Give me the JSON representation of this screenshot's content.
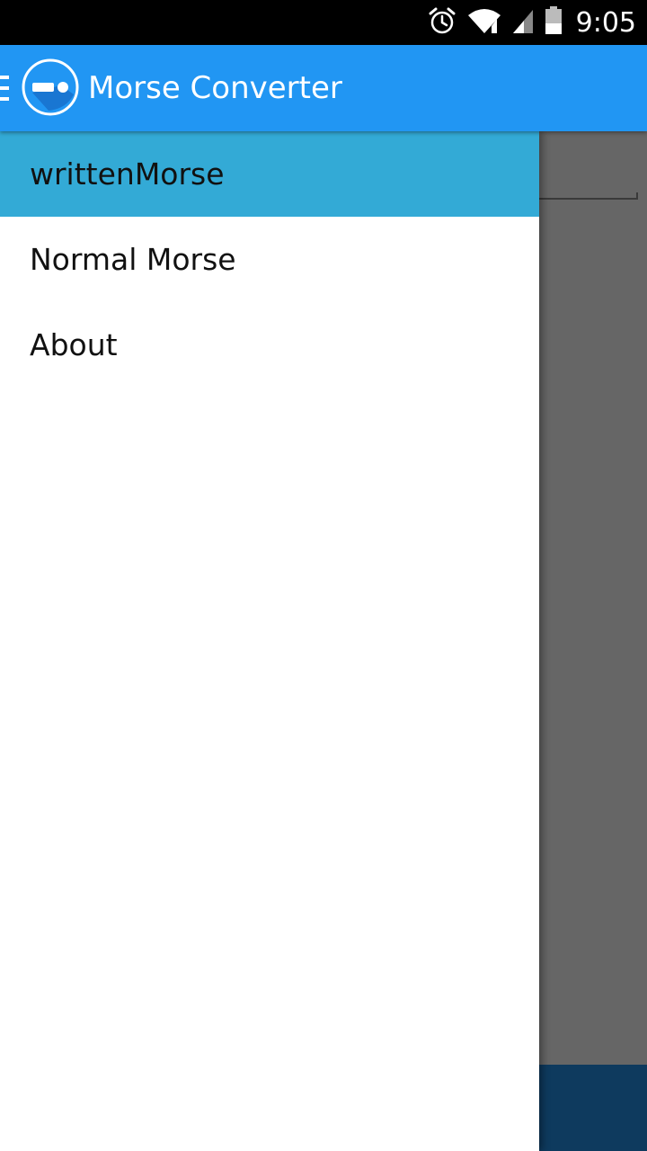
{
  "status_bar": {
    "time": "9:05",
    "icons": [
      "alarm-icon",
      "wifi-icon",
      "signal-icon",
      "battery-icon"
    ]
  },
  "app_bar": {
    "title": "Morse Converter",
    "color": "#2196F3",
    "menu_icon": "hamburger-menu-icon",
    "logo_icon": "morse-logo-icon"
  },
  "drawer": {
    "items": [
      {
        "label": "writtenMorse",
        "active": true
      },
      {
        "label": "Normal Morse",
        "active": false
      },
      {
        "label": "About",
        "active": false
      }
    ],
    "active_color": "#33AAD6"
  }
}
